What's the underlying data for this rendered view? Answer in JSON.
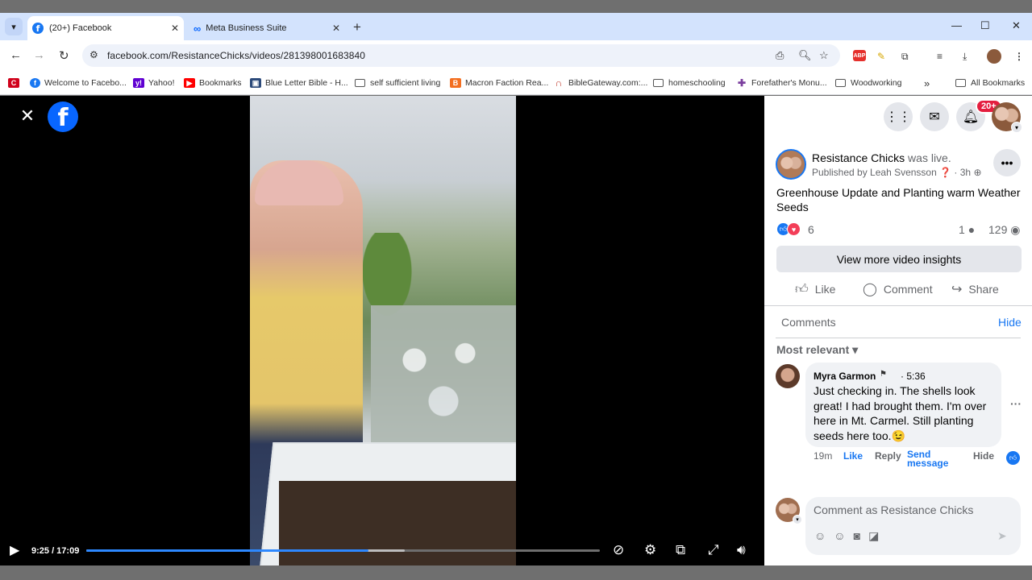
{
  "browser": {
    "tabs": [
      {
        "label": "(20+) Facebook",
        "active": true
      },
      {
        "label": "Meta Business Suite",
        "active": false
      }
    ],
    "url": "facebook.com/ResistanceChicks/videos/281398001683840",
    "bookmarks": [
      {
        "label": "Welcome to Facebo..."
      },
      {
        "label": "Yahoo!"
      },
      {
        "label": "Bookmarks"
      },
      {
        "label": "Blue Letter Bible - H..."
      },
      {
        "label": "self sufficient living"
      },
      {
        "label": "Macron Faction Rea..."
      },
      {
        "label": "BibleGateway.com:..."
      },
      {
        "label": "homeschooling"
      },
      {
        "label": "Forefather's Monu..."
      },
      {
        "label": "Woodworking"
      },
      {
        "label": "All Bookmarks"
      }
    ],
    "extension_badge": "ABP"
  },
  "video": {
    "current_time": "9:25 / 17:09",
    "progress_fraction": 0.549,
    "buffered_fraction": 0.62
  },
  "panel": {
    "notification_badge": "20+",
    "post": {
      "author": "Resistance Chicks",
      "status": " was live.",
      "published_by": "Published by Leah Svensson",
      "age": "3h",
      "title": "Greenhouse Update and Planting warm Weather Seeds",
      "reaction_count": "6",
      "comment_count": "1",
      "view_count": "129",
      "insights_label": "View more video insights",
      "actions": {
        "like": "Like",
        "comment": "Comment",
        "share": "Share"
      }
    },
    "comments_section": {
      "label": "Comments",
      "hide": "Hide",
      "sort": "Most relevant",
      "items": [
        {
          "author": "Myra Garmon",
          "time": "· 5:36",
          "text": "Just checking in. The shells look great! I had brought them. I'm over here in Mt. Carmel. Still planting seeds here too.😉",
          "age": "19m",
          "like": "Like",
          "reply": "Reply",
          "send_message": "Send message",
          "hide": "Hide"
        }
      ],
      "compose_placeholder": "Comment as Resistance Chicks"
    }
  },
  "colors": {
    "accent": "#1877f2",
    "tabstrip": "#d3e3fd",
    "badge": "#e41e3f"
  }
}
